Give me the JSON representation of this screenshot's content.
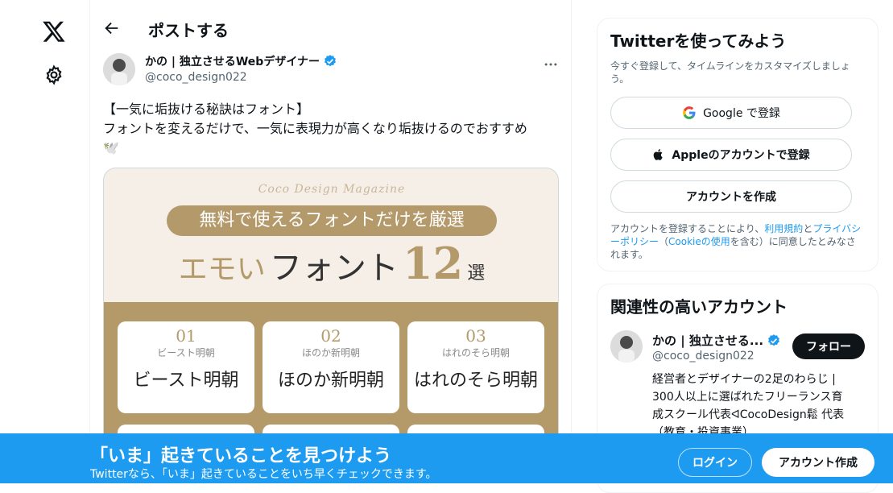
{
  "nav": {
    "logo_icon": "x-logo-icon",
    "settings_icon": "gear-icon"
  },
  "header": {
    "title": "ポストする",
    "back_icon": "arrow-left-icon"
  },
  "tweet": {
    "author_name": "かの | 独立させるWebデザイナー",
    "author_handle": "@coco_design022",
    "text_line1": "【一気に垢抜ける秘訣はフォント】",
    "text_line2": "フォントを変えるだけで、一気に表現力が高くなり垢抜けるのでおすすめ",
    "text_line3": "🕊️",
    "media": {
      "brand": "Coco Design Magazine",
      "banner": "無料で使えるフォントだけを厳選",
      "head_emo": "エモい",
      "head_font": "フォント",
      "head_num": "12",
      "head_sen": "選",
      "cards": [
        {
          "num": "01",
          "sub": "ビースト明朝",
          "big": "ビースト明朝"
        },
        {
          "num": "02",
          "sub": "ほのか新明朝",
          "big": "ほのか新明朝"
        },
        {
          "num": "03",
          "sub": "はれのそら明朝",
          "big": "はれのそら明朝"
        }
      ]
    }
  },
  "sidebar": {
    "signup_panel": {
      "title": "Twitterを使ってみよう",
      "subtitle": "今すぐ登録して、タイムラインをカスタマイズしましょう。",
      "google_btn": "Google で登録",
      "apple_btn": "Appleのアカウントで登録",
      "create_btn": "アカウントを作成",
      "legal_pre": "アカウントを登録することにより、",
      "legal_terms": "利用規約",
      "legal_and": "と",
      "legal_privacy": "プライバシーポリシー",
      "legal_paren_open": "（",
      "legal_cookie": "Cookieの使用",
      "legal_post": "を含む）に同意したとみなされます。"
    },
    "related": {
      "title": "関連性の高いアカウント",
      "name": "かの | 独立させる...",
      "handle": "@coco_design022",
      "follow": "フォロー",
      "bio": "経営者とデザイナーの2足のわらじ | 300人以上に選ばれたフリーランス育成スクール代表ᐊCocoDesign鬆 代表（教育・投資事業）"
    }
  },
  "footer": {
    "headline": "「いま」起きていることを見つけよう",
    "sub": "Twitterなら、「いま」起きていることをいち早くチェックできます。",
    "login": "ログイン",
    "signup": "アカウント作成"
  },
  "colors": {
    "accent": "#1d9bf0",
    "dark": "#0f1419",
    "gold": "#b49a6a"
  }
}
